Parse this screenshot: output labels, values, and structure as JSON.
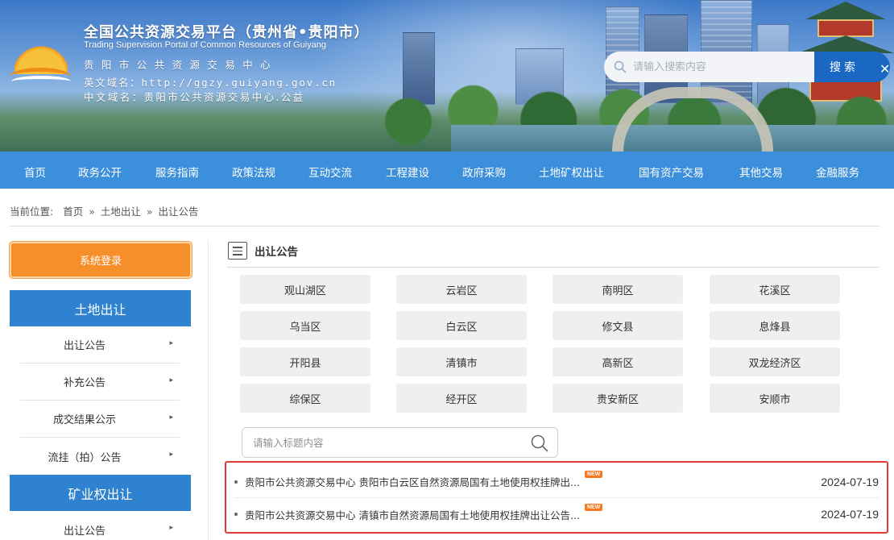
{
  "header": {
    "title": "全国公共资源交易平台（贵州省•贵阳市）",
    "subtitle_en": "Trading Supervision Portal of Common Resources of Guiyang",
    "center_name": "贵阳市公共资源交易中心",
    "domain_en": "英文域名：http://ggzy.guiyang.gov.cn",
    "domain_cn": "中文域名：贵阳市公共资源交易中心.公益",
    "search_placeholder": "请输入搜索内容",
    "search_button": "搜索",
    "close_glyph": "✕"
  },
  "nav": {
    "items": [
      "首页",
      "政务公开",
      "服务指南",
      "政策法规",
      "互动交流",
      "工程建设",
      "政府采购",
      "土地矿权出让",
      "国有资产交易",
      "其他交易",
      "金融服务"
    ]
  },
  "breadcrumb": {
    "label": "当前位置:",
    "items": [
      "首页",
      "土地出让",
      "出让公告"
    ],
    "separator": "»"
  },
  "sidebar": {
    "login_label": "系统登录",
    "sections": [
      {
        "title": "土地出让",
        "items": [
          "出让公告",
          "补充公告",
          "成交结果公示",
          "流挂（拍）公告"
        ]
      },
      {
        "title": "矿业权出让",
        "items": [
          "出让公告"
        ]
      }
    ],
    "arrow_glyph": "▸"
  },
  "main": {
    "section_title": "出让公告",
    "districts": [
      "观山湖区",
      "云岩区",
      "南明区",
      "花溪区",
      "乌当区",
      "白云区",
      "修文县",
      "息烽县",
      "开阳县",
      "清镇市",
      "高新区",
      "双龙经济区",
      "综保区",
      "经开区",
      "贵安新区",
      "安顺市"
    ],
    "title_search_placeholder": "请输入标题内容",
    "notices": [
      {
        "title": "贵阳市公共资源交易中心 贵阳市白云区自然资源局国有土地使用权挂牌出...",
        "badge": "NEW",
        "date": "2024-07-19"
      },
      {
        "title": "贵阳市公共资源交易中心 清镇市自然资源局国有土地使用权挂牌出让公告...",
        "badge": "NEW",
        "date": "2024-07-19"
      }
    ]
  },
  "colors": {
    "nav_bg": "#3c8fdb",
    "sidebar_head_bg": "#2f82d0",
    "login_bg": "#f68f2a",
    "search_button_bg": "#1a68c4",
    "highlight_border": "#e53935",
    "new_badge": "#f7781e"
  }
}
